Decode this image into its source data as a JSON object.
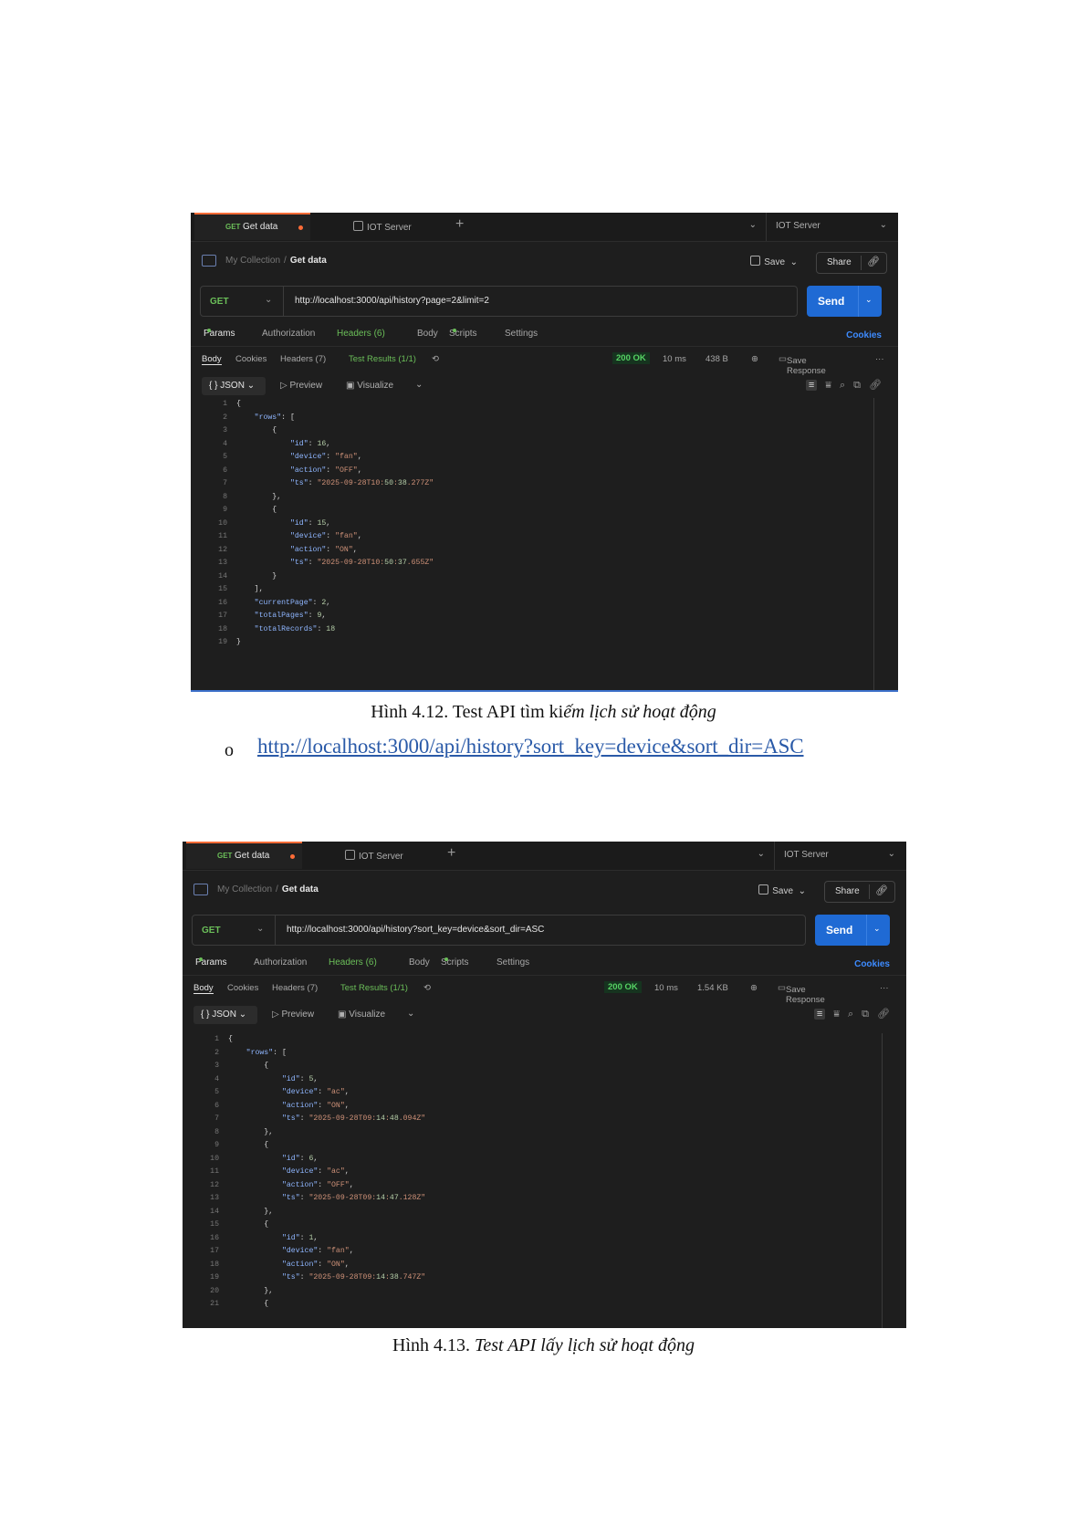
{
  "screenshots": [
    {
      "tab_method": "GET",
      "tab_name": "Get data",
      "tab2": "IOT Server",
      "env_name": "IOT Server",
      "breadcrumb_collection": "My Collection",
      "breadcrumb_sep": "/",
      "breadcrumb_request": "Get data",
      "save_label": "Save",
      "share_label": "Share",
      "method": "GET",
      "url": "http://localhost:3000/api/history?page=2&limit=2",
      "send_label": "Send",
      "req_tabs": [
        "Params",
        "Authorization",
        "Headers (6)",
        "Body",
        "Scripts",
        "Settings"
      ],
      "cookies_link": "Cookies",
      "res_tabs": [
        "Body",
        "Cookies",
        "Headers (7)",
        "Test Results (1/1)"
      ],
      "status": "200 OK",
      "time": "10 ms",
      "size": "438 B",
      "save_response": "Save Response",
      "format": "JSON",
      "preview": "Preview",
      "visualize": "Visualize",
      "code_lines": [
        "{",
        "    \"rows\": [",
        "        {",
        "            \"id\": 16,",
        "            \"device\": \"fan\",",
        "            \"action\": \"OFF\",",
        "            \"ts\": \"2025-09-28T10:50:38.277Z\"",
        "        },",
        "        {",
        "            \"id\": 15,",
        "            \"device\": \"fan\",",
        "            \"action\": \"ON\",",
        "            \"ts\": \"2025-09-28T10:50:37.655Z\"",
        "        }",
        "    ],",
        "    \"currentPage\": 2,",
        "    \"totalPages\": 9,",
        "    \"totalRecords\": 18",
        "}"
      ]
    },
    {
      "tab_method": "GET",
      "tab_name": "Get data",
      "tab2": "IOT Server",
      "env_name": "IOT Server",
      "breadcrumb_collection": "My Collection",
      "breadcrumb_sep": "/",
      "breadcrumb_request": "Get data",
      "save_label": "Save",
      "share_label": "Share",
      "method": "GET",
      "url": "http://localhost:3000/api/history?sort_key=device&sort_dir=ASC",
      "send_label": "Send",
      "req_tabs": [
        "Params",
        "Authorization",
        "Headers (6)",
        "Body",
        "Scripts",
        "Settings"
      ],
      "cookies_link": "Cookies",
      "res_tabs": [
        "Body",
        "Cookies",
        "Headers (7)",
        "Test Results (1/1)"
      ],
      "status": "200 OK",
      "time": "10 ms",
      "size": "1.54 KB",
      "save_response": "Save Response",
      "format": "JSON",
      "preview": "Preview",
      "visualize": "Visualize",
      "code_lines": [
        "{",
        "    \"rows\": [",
        "        {",
        "            \"id\": 5,",
        "            \"device\": \"ac\",",
        "            \"action\": \"ON\",",
        "            \"ts\": \"2025-09-28T09:14:48.094Z\"",
        "        },",
        "        {",
        "            \"id\": 6,",
        "            \"device\": \"ac\",",
        "            \"action\": \"OFF\",",
        "            \"ts\": \"2025-09-28T09:14:47.128Z\"",
        "        },",
        "        {",
        "            \"id\": 1,",
        "            \"device\": \"fan\",",
        "            \"action\": \"ON\",",
        "            \"ts\": \"2025-09-28T09:14:38.747Z\"",
        "        },",
        "        {"
      ]
    }
  ],
  "caption1_normal": "Hình 4.12. Test API tìm ki",
  "caption1_italic": "ếm lịch sử hoạt động",
  "bullet_marker": "o",
  "bullet_link": "http://localhost:3000/api/history?sort_key=device&sort_dir=ASC",
  "caption2_normal": "Hình 4.13. ",
  "caption2_italic": "Test API lấy lịch sử hoạt động"
}
